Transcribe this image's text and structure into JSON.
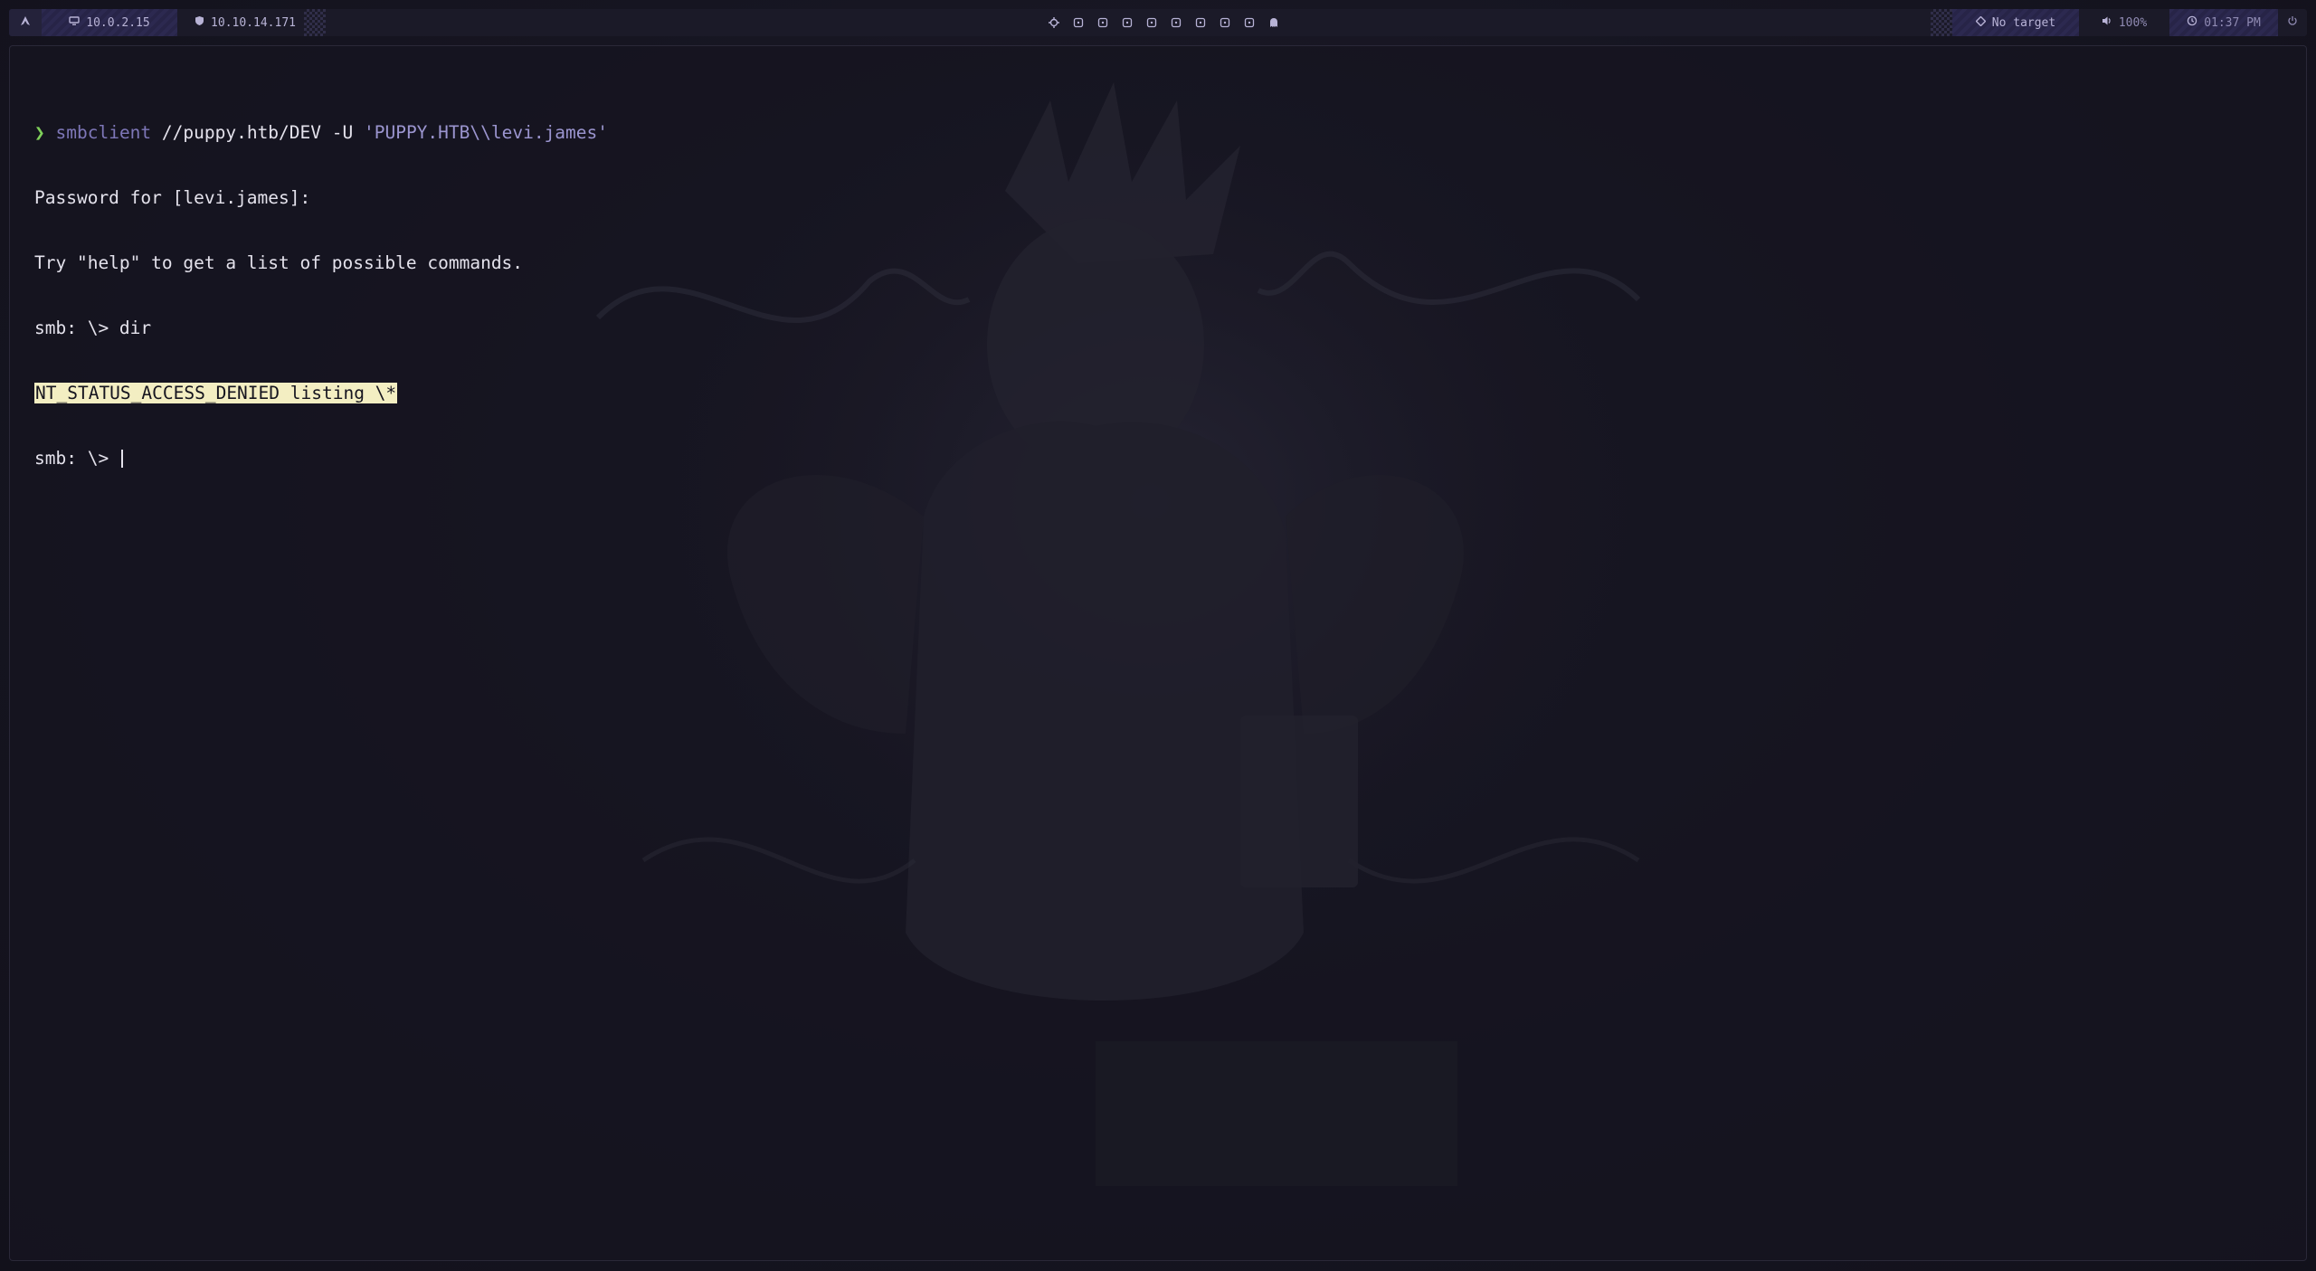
{
  "topbar": {
    "launcher_icon": "arch-logo-icon",
    "host_ip": "10.0.2.15",
    "vpn_ip": "10.10.14.171",
    "workspace_icons": [
      "target-icon",
      "terminal-icon",
      "terminal-icon",
      "terminal-icon",
      "terminal-icon",
      "terminal-icon",
      "terminal-icon",
      "terminal-icon",
      "terminal-icon",
      "ghost-icon"
    ],
    "target_label": "No target",
    "volume_label": "100%",
    "clock_label": "01:37 PM",
    "power_icon": "power-icon",
    "colors": {
      "bar_bg": "#1b1a28",
      "accent": "#2c2950",
      "text": "#b8b3d6"
    }
  },
  "terminal": {
    "prompt_symbol": "❯",
    "command": {
      "program": "smbclient",
      "args": " //puppy.htb/DEV -U ",
      "quoted": "'PUPPY.HTB\\\\levi.james'"
    },
    "output": [
      "Password for [levi.james]:",
      "Try \"help\" to get a list of possible commands.",
      "smb: \\> dir"
    ],
    "error_line": "NT_STATUS_ACCESS_DENIED listing \\*",
    "current_prompt": "smb: \\> ",
    "colors": {
      "prompt": "#7fd05a",
      "program": "#7e77b8",
      "quoted": "#9b95cf",
      "highlight_bg": "#f3eec2",
      "text": "#e4e2ec"
    }
  }
}
